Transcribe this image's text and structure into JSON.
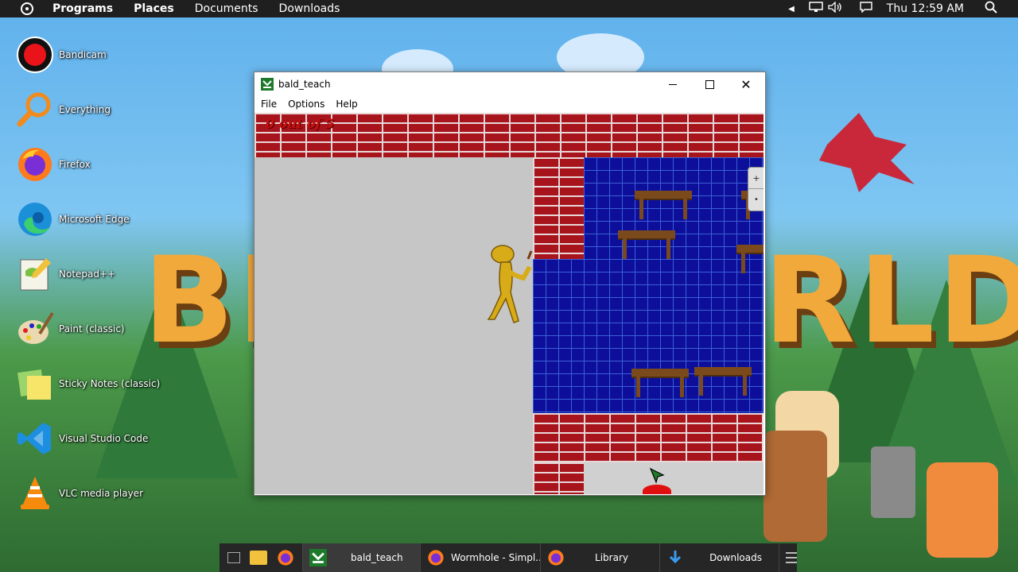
{
  "topbar": {
    "programs": "Programs",
    "places": "Places",
    "documents": "Documents",
    "downloads": "Downloads",
    "clock": "Thu 12:59 AM",
    "icons": [
      "apps-circle-icon",
      "arrow-left-icon",
      "network-icon",
      "volume-icon",
      "notification-icon",
      "search-icon"
    ]
  },
  "wallpaper": {
    "word_left": "BL",
    "word_right": "RLD"
  },
  "desktop": {
    "icons": [
      {
        "label": "Bandicam",
        "icon": "bandicam-icon"
      },
      {
        "label": "Everything",
        "icon": "everything-search-icon"
      },
      {
        "label": "Firefox",
        "icon": "firefox-icon"
      },
      {
        "label": "Microsoft Edge",
        "icon": "edge-icon"
      },
      {
        "label": "Notepad++",
        "icon": "notepadpp-icon"
      },
      {
        "label": "Paint (classic)",
        "icon": "paint-icon"
      },
      {
        "label": "Sticky Notes (classic)",
        "icon": "sticky-notes-icon"
      },
      {
        "label": "Visual Studio Code",
        "icon": "vscode-icon"
      },
      {
        "label": "VLC media player",
        "icon": "vlc-icon"
      }
    ]
  },
  "window": {
    "title": "bald_teach",
    "menu": {
      "file": "File",
      "options": "Options",
      "help": "Help"
    },
    "controls": {
      "minimize": "—",
      "maximize": "☐",
      "close": "✕"
    },
    "game": {
      "score_text": "0 out of 5",
      "scroll_plus": "+",
      "scroll_dot": "•"
    }
  },
  "taskbar": {
    "items": [
      {
        "label": "bald_teach",
        "icon": "bald-teach-icon",
        "active": true
      },
      {
        "label": "Wormhole - Simpl...",
        "icon": "firefox-icon",
        "active": false
      },
      {
        "label": "Library",
        "icon": "firefox-icon",
        "active": false
      },
      {
        "label": "Downloads",
        "icon": "download-arrow-icon",
        "active": false
      }
    ],
    "quick": [
      "show-desktop-icon",
      "file-manager-icon",
      "firefox-icon"
    ],
    "menu_icon": "hamburger-menu-icon"
  },
  "colors": {
    "brick": "#a8141c",
    "floor": "#0d0f9a",
    "score": "#c81010",
    "topbar": "#1f1f1f",
    "taskbar": "#262626"
  }
}
